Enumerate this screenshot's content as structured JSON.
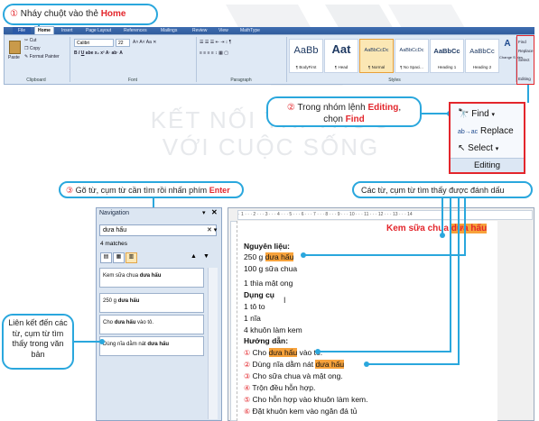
{
  "watermark": {
    "line1": "KẾT NỐI TRI THỨC",
    "line2": "VỚI CUỘC SỐNG"
  },
  "callouts": {
    "step1": {
      "num": "①",
      "text": " Nháy chuột vào thẻ ",
      "highlight": "Home"
    },
    "step2": {
      "num": "②",
      "text": " Trong nhóm lệnh ",
      "highlight": "Editing",
      "text2": ",",
      "line2": "chọn ",
      "highlight2": "Find"
    },
    "step3": {
      "num": "③",
      "text": " Gõ từ, cụm từ cần tìm rồi nhấn phím ",
      "highlight": "Enter"
    },
    "found": {
      "text": "Các từ, cụm từ tìm thấy được đánh dấu"
    },
    "links": {
      "text": "Liên kết đến các từ, cụm từ tìm thấy trong văn bản"
    }
  },
  "ribbon": {
    "tabs": [
      "File",
      "Home",
      "Insert",
      "Page Layout",
      "References",
      "Mailings",
      "Review",
      "View",
      "MathType"
    ],
    "clipboard": {
      "paste": "Paste",
      "cut": "Cut",
      "copy": "Copy",
      "format_painter": "Format Painter",
      "label": "Clipboard"
    },
    "font": {
      "name": "Calibri",
      "size": "22",
      "label": "Font"
    },
    "paragraph": {
      "label": "Paragraph"
    },
    "styles": {
      "label": "Styles",
      "items": [
        {
          "sample": "AaBb",
          "name": "¶ BodyFirst"
        },
        {
          "sample": "Aat",
          "name": "¶ Head"
        },
        {
          "sample": "AaBbCcDc",
          "name": "¶ Normal"
        },
        {
          "sample": "AaBbCcDc",
          "name": "¶ No Spaci..."
        },
        {
          "sample": "AaBbCc",
          "name": "Heading 1"
        },
        {
          "sample": "AaBbCc",
          "name": "Heading 2"
        }
      ],
      "change": "Change Styles"
    },
    "editing": {
      "find": "Find",
      "replace": "Replace",
      "select": "Select",
      "label": "Editing"
    }
  },
  "editing_zoom": {
    "find": "Find",
    "replace": "Replace",
    "select": "Select",
    "label": "Editing"
  },
  "navigation": {
    "title": "Navigation",
    "search_value": "dưa hấu",
    "matches": "4 matches",
    "results": [
      {
        "pre": "Kem sữa chua ",
        "match": "dưa hấu",
        "post": ""
      },
      {
        "pre": "250 g ",
        "match": "dưa hấu",
        "post": ""
      },
      {
        "pre": "Cho ",
        "match": "dưa hấu",
        "post": " vào tô."
      },
      {
        "pre": "Dùng nĩa dằm nát ",
        "match": "dưa hấu",
        "post": ""
      }
    ]
  },
  "document": {
    "title_pre": "Kem sữa chua ",
    "title_match": "dưa hấu",
    "ingredients_heading": "Nguyên liệu:",
    "ing1_pre": "250 g ",
    "ing1_match": "dưa hấu",
    "ing2": "100 g sữa chua",
    "ing3": "1 thìa mật ong",
    "tools_heading": "Dụng cụ",
    "tool1": "1 tô to",
    "tool2": "1 nĩa",
    "tool3": "4 khuôn làm kem",
    "steps_heading": "Hướng dẫn:",
    "steps": [
      {
        "num": "①",
        "pre": " Cho ",
        "match": "dưa hấu",
        "post": " vào tô."
      },
      {
        "num": "②",
        "pre": " Dùng nĩa dằm nát ",
        "match": "dưa hấu",
        "post": ""
      },
      {
        "num": "③",
        "pre": " Cho sữa chua và mật ong.",
        "match": "",
        "post": ""
      },
      {
        "num": "④",
        "pre": " Trộn đều hỗn hợp.",
        "match": "",
        "post": ""
      },
      {
        "num": "⑤",
        "pre": " Cho hỗn hợp vào khuôn làm kem.",
        "match": "",
        "post": ""
      },
      {
        "num": "⑥",
        "pre": " Đặt khuôn kem vào ngăn đá tủ",
        "match": "",
        "post": ""
      }
    ]
  },
  "colors": {
    "accent": "#2aa7dd",
    "highlight": "#f7a23b",
    "emphasis": "#e3262c"
  }
}
